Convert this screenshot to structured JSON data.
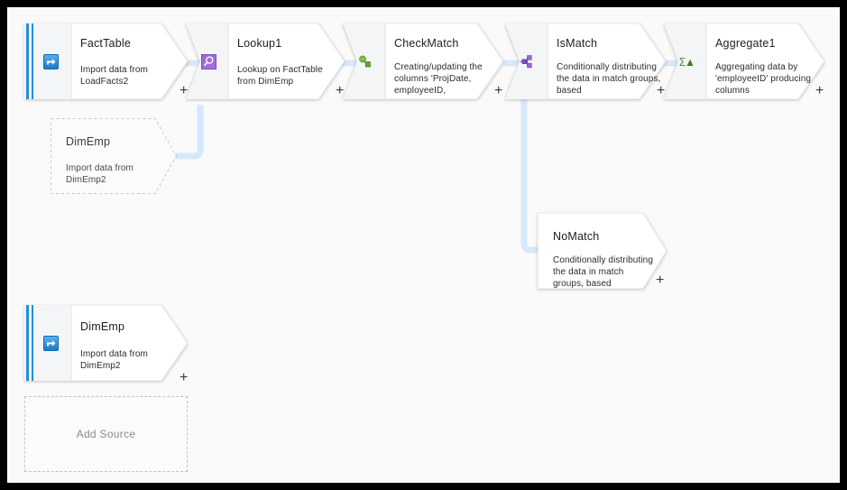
{
  "canvas": {
    "background_color": "#fafafa",
    "frame_color": "#000000",
    "connector_color": "#d6e9fb",
    "source_bar_color": "#1f8fe0"
  },
  "add_source": {
    "label": "Add Source"
  },
  "nodes": [
    {
      "id": "facttable",
      "title": "FactTable",
      "description": "Import data from LoadFacts2",
      "icon": "source-import-icon",
      "icon_color": "#2a8ee0",
      "plus": "+",
      "style": "source"
    },
    {
      "id": "lookup1",
      "title": "Lookup1",
      "description": "Lookup on FactTable from DimEmp",
      "icon": "lookup-magnifier-icon",
      "icon_color": "#8b5ccc",
      "plus": "+",
      "style": "transform"
    },
    {
      "id": "checkmatch",
      "title": "CheckMatch",
      "description": "Creating/updating the columns 'ProjDate, employeeID,",
      "icon": "derived-column-icon",
      "icon_color": "#6cb33f",
      "plus": "+",
      "style": "transform"
    },
    {
      "id": "ismatch",
      "title": "IsMatch",
      "description": "Conditionally distributing the data in match groups, based",
      "icon": "conditional-split-icon",
      "icon_color": "#7b5cc7",
      "plus": "+",
      "style": "transform"
    },
    {
      "id": "aggregate1",
      "title": "Aggregate1",
      "description": "Aggregating data by 'employeeID' producing columns",
      "icon": "aggregate-sigma-icon",
      "icon_color": "#5aa832",
      "plus": "+",
      "style": "transform"
    },
    {
      "id": "dimemp-ghost",
      "title": "DimEmp",
      "description": "Import data from DimEmp2",
      "icon": "none",
      "plus": "",
      "style": "ghost"
    },
    {
      "id": "nomatch",
      "title": "NoMatch",
      "description": "Conditionally distributing the data in match groups, based",
      "icon": "none",
      "plus": "+",
      "style": "plain"
    },
    {
      "id": "dimemp-source",
      "title": "DimEmp",
      "description": "Import data from DimEmp2",
      "icon": "source-import-icon",
      "icon_color": "#2a8ee0",
      "plus": "+",
      "style": "source"
    }
  ]
}
